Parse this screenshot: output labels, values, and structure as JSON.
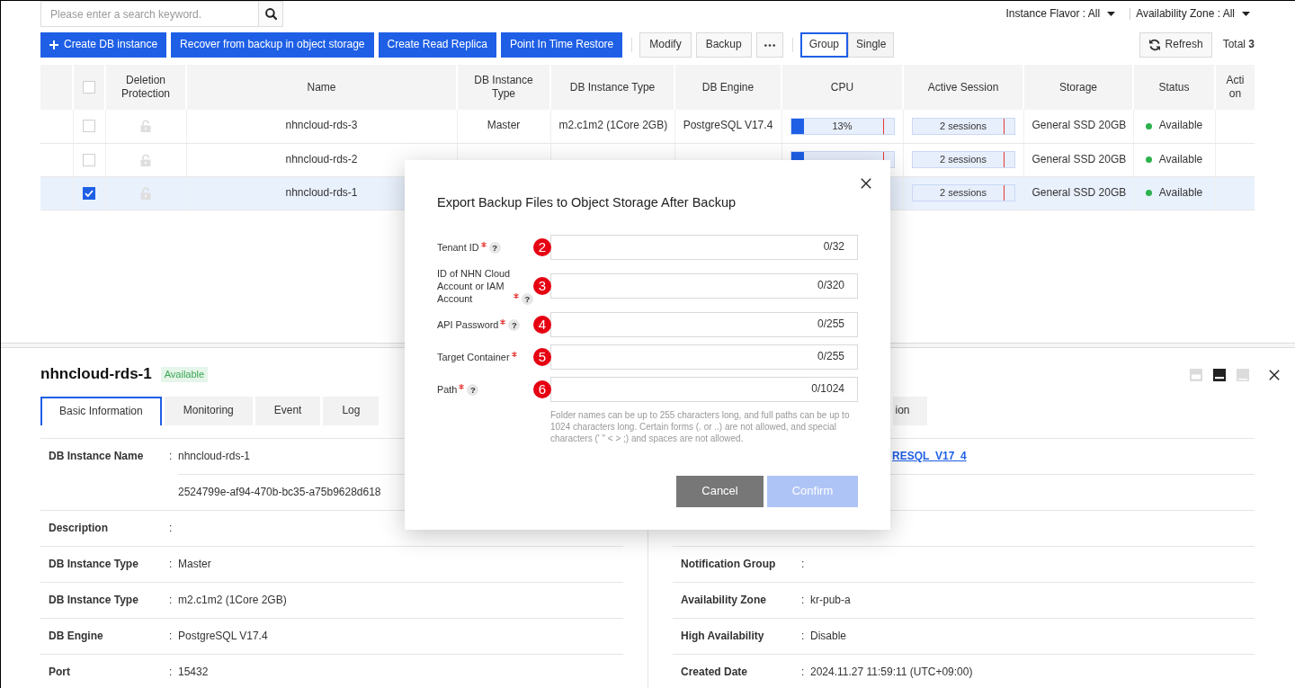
{
  "search": {
    "placeholder": "Please enter a search keyword."
  },
  "filters": [
    {
      "label": "Instance Flavor : All"
    },
    {
      "label": "Availability Zone : All"
    }
  ],
  "toolbar": {
    "actions": [
      {
        "kind": "create",
        "label": "Create DB instance"
      },
      {
        "kind": "plain",
        "label": "Recover from backup in object storage"
      },
      {
        "kind": "plain",
        "label": "Create Read Replica"
      },
      {
        "kind": "plain",
        "label": "Point In Time Restore"
      }
    ],
    "tools": [
      {
        "kind": "text",
        "label": "Modify"
      },
      {
        "kind": "text",
        "label": "Backup"
      },
      {
        "kind": "more"
      }
    ],
    "view_modes": [
      {
        "label": "Group",
        "selected": true
      },
      {
        "label": "Single",
        "selected": false
      }
    ],
    "refresh": {
      "label": "Refresh"
    },
    "total": "Total **3**"
  },
  "table": {
    "select_all": {
      "checked": false
    },
    "columns": [
      "Deletion Protection",
      "Name",
      "DB Instance Type",
      "DB Instance Type",
      "DB Engine",
      "CPU",
      "Active Session",
      "Storage",
      "Status",
      "Action"
    ],
    "rows": [
      {
        "checked": false,
        "selected": false,
        "deletion_protection": false,
        "name": "nhncloud-rds-3",
        "instance_type": "Master",
        "flavor": "m2.c1m2 (1Core 2GB)",
        "engine": "PostgreSQL V17.4",
        "cpu": {
          "level": 0.13,
          "reading": "13%"
        },
        "session": {
          "reading": "2 sessions"
        },
        "storage": "General SSD 20GB",
        "status": {
          "label": "Available",
          "color": "#2bb24c"
        }
      },
      {
        "checked": false,
        "selected": false,
        "deletion_protection": false,
        "name": "nhncloud-rds-2",
        "cpu": {
          "level": 0.13
        },
        "session": {
          "reading": "2 sessions"
        },
        "storage": "General SSD 20GB",
        "status": {
          "label": "Available",
          "color": "#2bb24c"
        }
      },
      {
        "checked": true,
        "selected": true,
        "deletion_protection": false,
        "name": "nhncloud-rds-1",
        "session": {
          "reading": "2 sessions"
        },
        "storage": "General SSD 20GB",
        "status": {
          "label": "Available",
          "color": "#2bb24c"
        }
      }
    ]
  },
  "detail": {
    "title": "nhncloud-rds-1",
    "status": "Available",
    "layouts": [
      {
        "kind": "top",
        "selected": false
      },
      {
        "kind": "bottom",
        "selected": true
      },
      {
        "kind": "full",
        "selected": false
      }
    ],
    "tabs": [
      {
        "label": "Basic Information",
        "selected": true
      },
      {
        "label": "Monitoring",
        "selected": false
      },
      {
        "label": "Event",
        "selected": false
      },
      {
        "label": "Log",
        "selected": false
      }
    ],
    "clipped_tabs": [
      {
        "label": "ion",
        "selected": false
      }
    ],
    "left_fields": [
      {
        "label": "DB Instance Name",
        "separator": ":",
        "values": [
          "nhncloud-rds-1",
          "2524799e-af94-470b-bc35-a75b9628d618"
        ]
      },
      {
        "label": "Description",
        "separator": ":"
      },
      {
        "label": "DB Instance Type",
        "separator": ":",
        "values": [
          "Master"
        ]
      },
      {
        "label": "DB Instance Type",
        "separator": ":",
        "values": [
          "m2.c1m2 (1Core 2GB)"
        ]
      },
      {
        "label": "DB Engine",
        "separator": ":",
        "values": [
          "PostgreSQL V17.4"
        ]
      },
      {
        "label": "Port",
        "separator": ":",
        "values": [
          "15432"
        ]
      }
    ],
    "right_fields": [
      {
        "kind": "clipped_link",
        "value": "RESQL_V17_4"
      },
      {
        "kind": "covered"
      },
      {
        "kind": "covered"
      },
      {
        "kind": "text",
        "label": "Notification Group",
        "separator": ":"
      },
      {
        "kind": "text",
        "label": "Availability Zone",
        "separator": ":",
        "values": [
          "kr-pub-a"
        ]
      },
      {
        "kind": "text",
        "label": "High Availability",
        "separator": ":",
        "values": [
          "Disable"
        ]
      },
      {
        "kind": "text",
        "label": "Created Date",
        "separator": ":",
        "values": [
          "2024.11.27 11:59:11 (UTC+09:00)"
        ]
      }
    ]
  },
  "dialog": {
    "title": "Export Backup Files to Object Storage After Backup",
    "fields": [
      {
        "label": "Tenant ID",
        "required": true,
        "help": "?",
        "counter": "0/32",
        "step": "2"
      },
      {
        "label": "ID of NHN Cloud Account or IAM Account",
        "required": true,
        "help": "?",
        "counter": "0/320",
        "step": "3"
      },
      {
        "label": "API Password",
        "required": true,
        "help": "?",
        "counter": "0/255",
        "step": "4"
      },
      {
        "label": "Target Container",
        "required": true,
        "counter": "0/255",
        "step": "5"
      },
      {
        "label": "Path",
        "required": true,
        "help": "?",
        "counter": "0/1024",
        "step": "6"
      }
    ],
    "hint": "Folder names can be up to 255 characters long, and full paths can be up to 1024 characters long. Certain forms (. or ..) are not allowed, and special characters (' \" < > ;) and spaces are not allowed.",
    "buttons": [
      {
        "kind": "cancel",
        "label": "Cancel",
        "disabled": false
      },
      {
        "kind": "confirm",
        "label": "Confirm",
        "disabled": true
      }
    ]
  }
}
